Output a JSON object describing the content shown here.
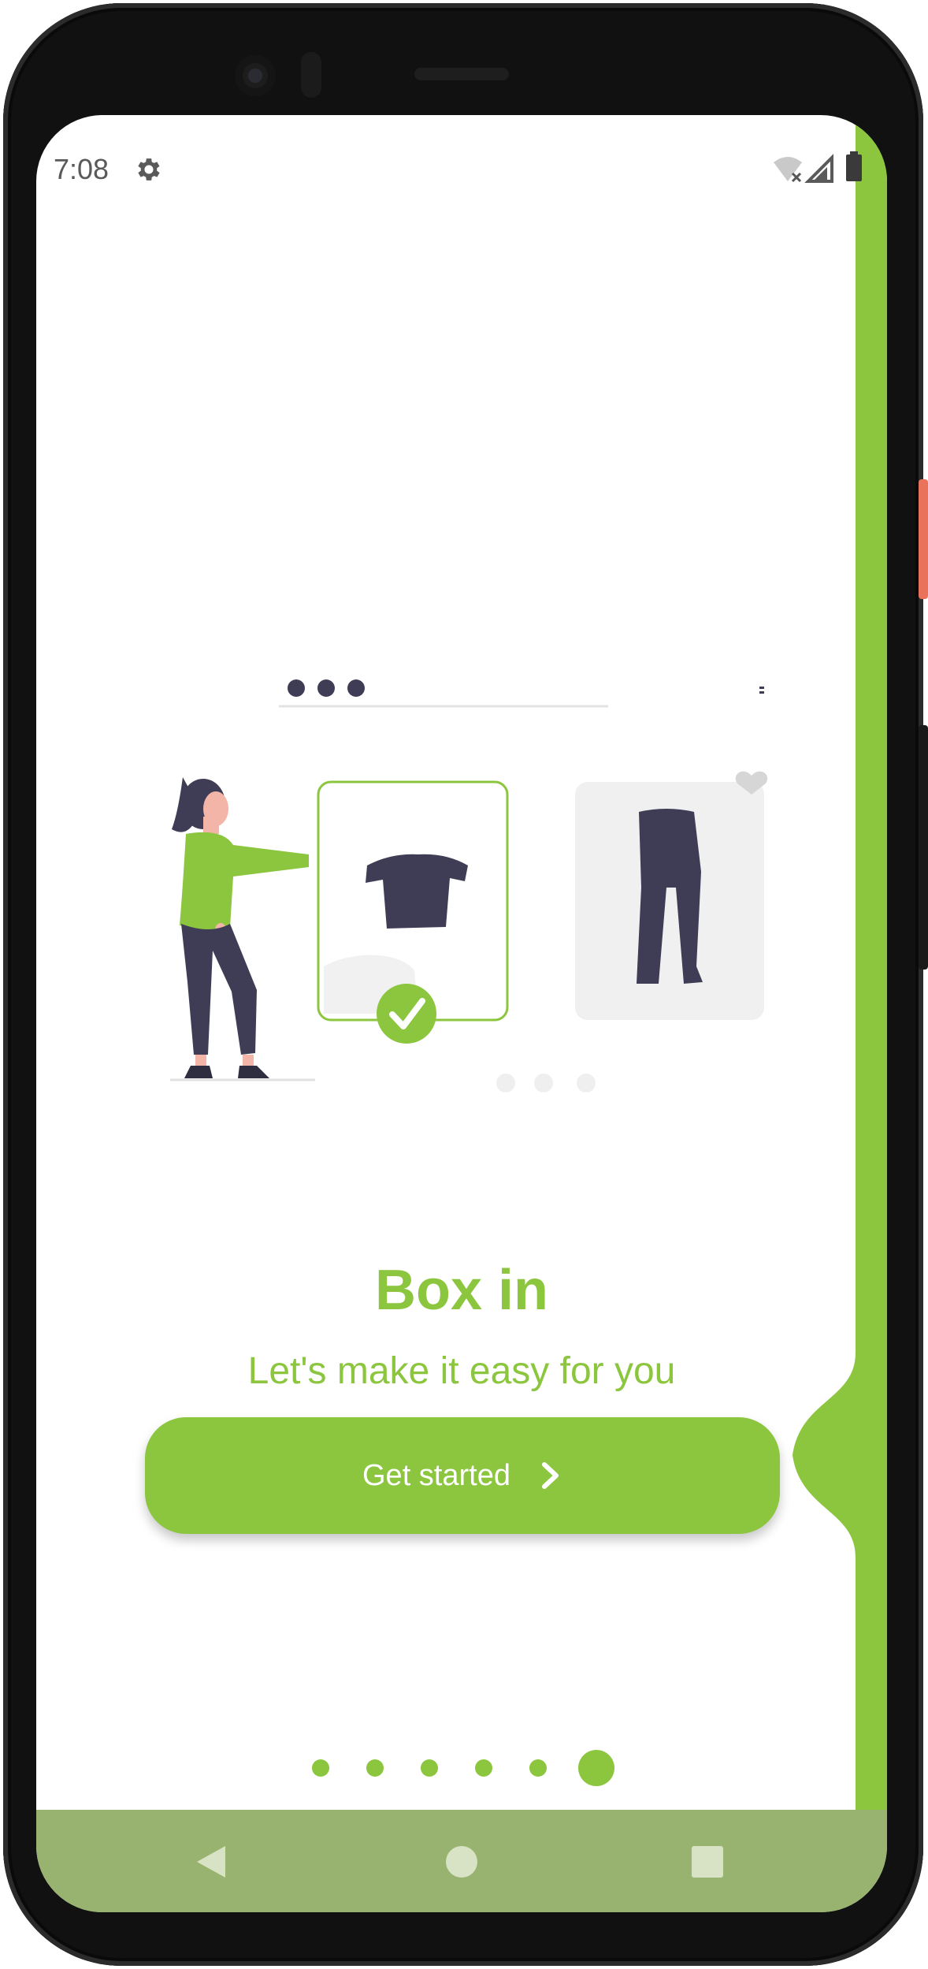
{
  "status_bar": {
    "time": "7:08",
    "icons": [
      "gear-icon",
      "wifi-off-icon",
      "signal-icon",
      "battery-icon"
    ]
  },
  "onboarding": {
    "title": "Box in",
    "subtitle": "Let's make it easy for you",
    "cta_label": "Get started",
    "cta_icon": "chevron-right-icon",
    "page_count": 6,
    "current_page": 6
  },
  "nav_bar": {
    "buttons": [
      "back-icon",
      "home-icon",
      "recents-icon"
    ]
  },
  "colors": {
    "accent": "#8cc63f",
    "nav_bar": "#98b36f",
    "illustration_dark": "#3f3d56",
    "illustration_light": "#f0f0f0"
  }
}
